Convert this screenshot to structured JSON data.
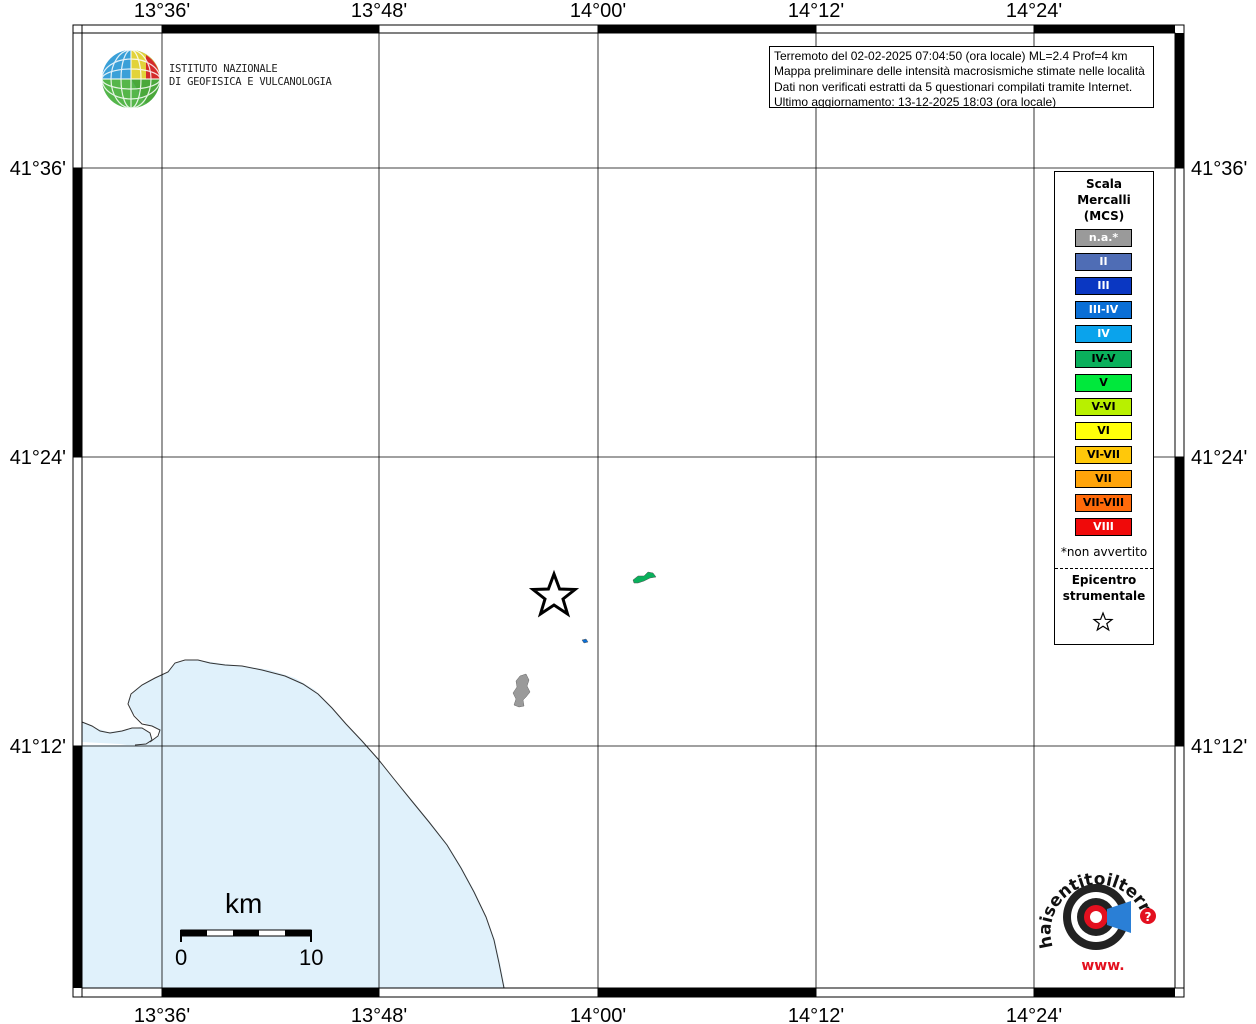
{
  "map": {
    "lon_ticks": [
      "13°36'",
      "13°48'",
      "14°00'",
      "14°12'",
      "14°24'"
    ],
    "lat_ticks": [
      "41°36'",
      "41°24'",
      "41°12'"
    ],
    "colors": {
      "sea": "#e0f1fb",
      "coast": "#333333"
    }
  },
  "header": {
    "institute_line1": "ISTITUTO NAZIONALE",
    "institute_line2": "DI GEOFISICA E VULCANOLOGIA"
  },
  "info": {
    "line1": "Terremoto del 02-02-2025 07:04:50 (ora locale) ML=2.4 Prof=4 km",
    "line2": "Mappa preliminare delle intensità macrosismiche stimate nelle località",
    "line3": "Dati non verificati estratti da 5 questionari compilati tramite Internet.",
    "line4": "Ultimo aggiornamento: 13-12-2025 18:03 (ora locale)"
  },
  "legend": {
    "title_line1": "Scala",
    "title_line2": "Mercalli",
    "title_line3": "(MCS)",
    "items": [
      {
        "label": "n.a.*",
        "color": "#9a9a9a",
        "text_color": "#ffffff"
      },
      {
        "label": "II",
        "color": "#4f6db5",
        "text_color": "#ffffff"
      },
      {
        "label": "III",
        "color": "#0a37c2",
        "text_color": "#ffffff"
      },
      {
        "label": "III-IV",
        "color": "#0a6fd6",
        "text_color": "#ffffff"
      },
      {
        "label": "IV",
        "color": "#0aa3ec",
        "text_color": "#ffffff"
      },
      {
        "label": "IV-V",
        "color": "#0ab05c",
        "text_color": "#000000"
      },
      {
        "label": "V",
        "color": "#00e83c",
        "text_color": "#000000"
      },
      {
        "label": "V-VI",
        "color": "#b8f000",
        "text_color": "#000000"
      },
      {
        "label": "VI",
        "color": "#ffff0a",
        "text_color": "#000000"
      },
      {
        "label": "VI-VII",
        "color": "#ffc80a",
        "text_color": "#000000"
      },
      {
        "label": "VII",
        "color": "#ffa40a",
        "text_color": "#000000"
      },
      {
        "label": "VII-VIII",
        "color": "#ff6a0a",
        "text_color": "#000000"
      },
      {
        "label": "VIII",
        "color": "#f00a0a",
        "text_color": "#ffffff"
      }
    ],
    "note": "*non avvertito",
    "epicenter_line1": "Epicentro",
    "epicenter_line2": "strumentale"
  },
  "scalebar": {
    "unit": "km",
    "start": "0",
    "end": "10"
  },
  "hsi_logo": {
    "text_ring": "haisentitoilterremoto.it",
    "url": "www.",
    "badge": "?"
  }
}
